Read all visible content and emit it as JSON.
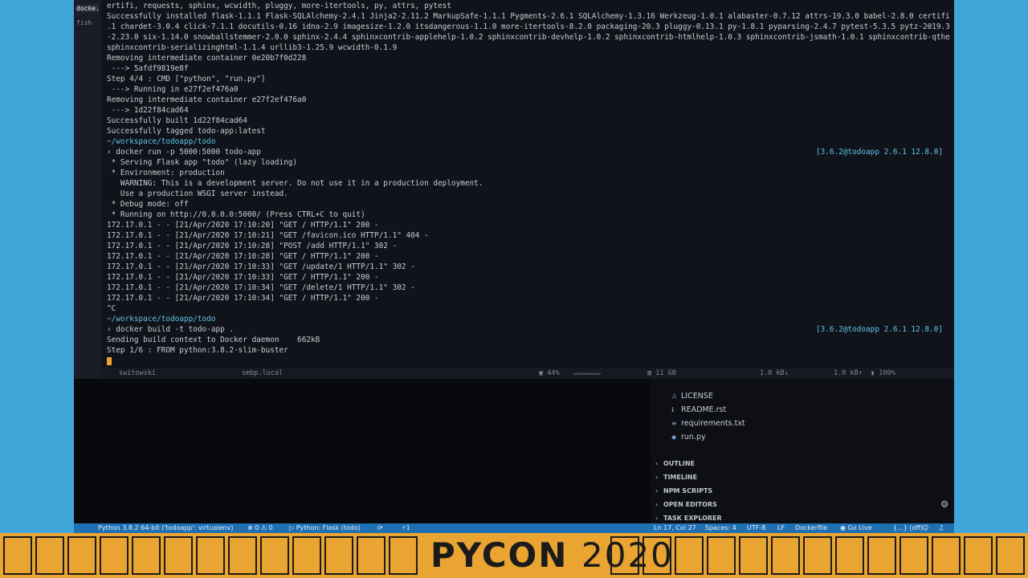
{
  "terminal": {
    "tabs": [
      "docke...",
      "fish"
    ],
    "lines": [
      "ertifi, requests, sphinx, wcwidth, pluggy, more-itertools, py, attrs, pytest",
      "Successfully installed flask-1.1.1 Flask-SQLAlchemy-2.4.1 Jinja2-2.11.2 MarkupSafe-1.1.1 Pygments-2.6.1 SQLAlchemy-1.3.16 Werkzeug-1.0.1 alabaster-0.7.12 attrs-19.3.0 babel-2.8.0 certifi-2020.4.5",
      ".1 chardet-3.0.4 click-7.1.1 docutils-0.16 idna-2.9 imagesize-1.2.0 itsdangerous-1.1.0 more-itertools-8.2.0 packaging-20.3 pluggy-0.13.1 py-1.8.1 pyparsing-2.4.7 pytest-5.3.5 pytz-2019.3 requests",
      "-2.23.0 six-1.14.0 snowballstemmer-2.0.0 sphinx-2.4.4 sphinxcontrib-applehelp-1.0.2 sphinxcontrib-devhelp-1.0.2 sphinxcontrib-htmlhelp-1.0.3 sphinxcontrib-jsmath-1.0.1 sphinxcontrib-qthelp-1.0.3",
      "sphinxcontrib-serializinghtml-1.1.4 urllib3-1.25.9 wcwidth-0.1.9",
      "Removing intermediate container 0e20b7f0d228",
      " ---> 5afdf9819e8f",
      "Step 4/4 : CMD [\"python\", \"run.py\"]",
      " ---> Running in e27f2ef476a0",
      "Removing intermediate container e27f2ef476a0",
      " ---> 1d22f84cad64",
      "Successfully built 1d22f84cad64",
      "Successfully tagged todo-app:latest",
      "~/workspace/todoapp/todo",
      "› docker run -p 5000:5000 todo-app",
      " * Serving Flask app \"todo\" (lazy loading)",
      " * Environment: production",
      "   WARNING: This is a development server. Do not use it in a production deployment.",
      "   Use a production WSGI server instead.",
      " * Debug mode: off",
      " * Running on http://0.0.0.0:5000/ (Press CTRL+C to quit)",
      "172.17.0.1 - - [21/Apr/2020 17:10:20] \"GET / HTTP/1.1\" 200 -",
      "172.17.0.1 - - [21/Apr/2020 17:10:21] \"GET /favicon.ico HTTP/1.1\" 404 -",
      "172.17.0.1 - - [21/Apr/2020 17:10:28] \"POST /add HTTP/1.1\" 302 -",
      "172.17.0.1 - - [21/Apr/2020 17:10:28] \"GET / HTTP/1.1\" 200 -",
      "172.17.0.1 - - [21/Apr/2020 17:10:33] \"GET /update/1 HTTP/1.1\" 302 -",
      "172.17.0.1 - - [21/Apr/2020 17:10:33] \"GET / HTTP/1.1\" 200 -",
      "172.17.0.1 - - [21/Apr/2020 17:10:34] \"GET /delete/1 HTTP/1.1\" 302 -",
      "172.17.0.1 - - [21/Apr/2020 17:10:34] \"GET / HTTP/1.1\" 200 -",
      "^C",
      "~/workspace/todoapp/todo",
      "› docker build -t todo-app .",
      "Sending build context to Docker daemon    662kB",
      "Step 1/6 : FROM python:3.8.2-slim-buster"
    ],
    "prompt_right_1": "[3.6.2@todoapp 2.6.1 12.8.0]",
    "prompt_right_2": "[3.6.2@todoapp 2.6.1 12.8.0]",
    "status": {
      "user": "switowski",
      "host": "smbp.local",
      "cpu": "44%",
      "mem": "11 GB",
      "net_down": "1.0 kB↓",
      "net_up": "1.0 kB↑",
      "battery": "100%"
    }
  },
  "explorer": {
    "files": [
      "LICENSE",
      "README.rst",
      "requirements.txt",
      "run.py"
    ],
    "sections": [
      "OUTLINE",
      "TIMELINE",
      "NPM SCRIPTS",
      "OPEN EDITORS",
      "TASK EXPLORER"
    ]
  },
  "vscode_status": {
    "python": "Python 3.8.2 64-bit ('todoapp': virtualenv)",
    "problems": "⊗ 0 ⚠ 0",
    "run_config": "▷ Python: Flask (todo)",
    "pos": "Ln 17, Col 27",
    "spaces": "Spaces: 4",
    "encoding": "UTF-8",
    "eol": "LF",
    "lang": "Dockerfile",
    "golive": "Go Live",
    "off": "{...} (off)"
  },
  "banner": {
    "pycon": "PYCON",
    "year": "2020"
  },
  "colors": {
    "accent": "#e9a431",
    "side": "#3fa6d8",
    "path": "#5ec4e8",
    "status_bar": "#1f6fb3"
  }
}
